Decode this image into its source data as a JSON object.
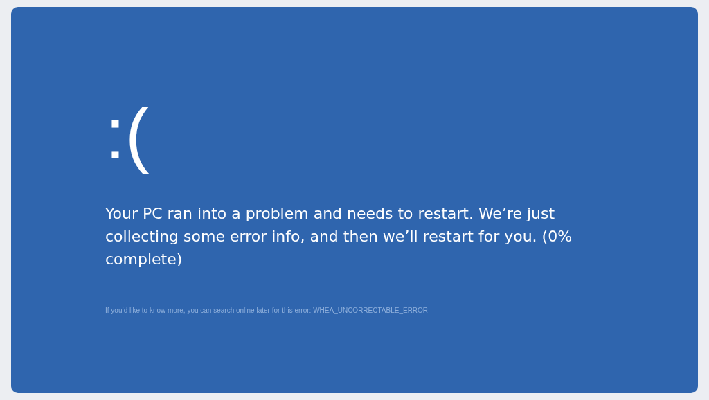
{
  "screen": {
    "emoticon": ":(",
    "message": "Your PC ran into a problem and needs to restart. We’re just collecting some error info, and then we’ll restart for you. (0% complete)",
    "hint": "If you’d like to know more, you can search online later for this error: WHEA_UNCORRECTABLE_ERROR"
  }
}
